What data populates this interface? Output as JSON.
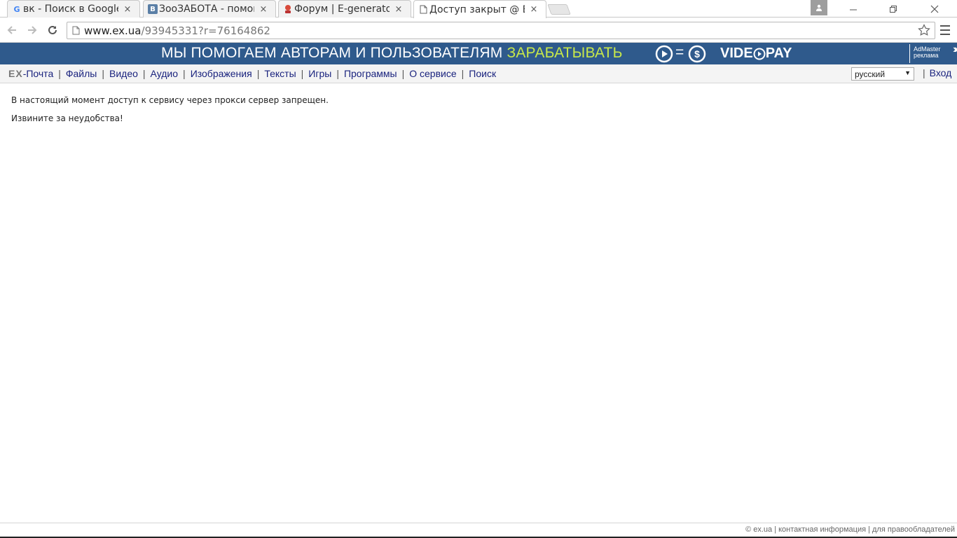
{
  "browser": {
    "tabs": [
      {
        "title": "вк - Поиск в Google",
        "favicon": "google-g"
      },
      {
        "title": "ЗооЗАБОТА - помощ",
        "favicon": "vk-b"
      },
      {
        "title": "Форум | E-generator",
        "favicon": "egenerator"
      },
      {
        "title": "Доступ закрыт @ EX",
        "favicon": "page"
      }
    ],
    "close_glyph": "×",
    "url_host": "www.ex.ua",
    "url_path": "/93945331?r=76164862"
  },
  "banner": {
    "slogan_part1": "МЫ ПОМОГАЕМ АВТОРАМ И ПОЛЬЗОВАТЕЛЯМ ",
    "slogan_highlight": "ЗАРАБАТЫВАТЬ",
    "equals": "=",
    "brand_left": "VIDE",
    "brand_right": "PAY",
    "ad_line1": "AdMaster",
    "ad_line2": "реклама",
    "highlight_color": "#c8e84a",
    "bg_color": "#2f5a8c"
  },
  "nav": {
    "logo": "EX",
    "items": [
      "-Почта",
      "Файлы",
      "Видео",
      "Аудио",
      "Изображения",
      "Тексты",
      "Игры",
      "Программы",
      "О сервисе",
      "Поиск"
    ],
    "separator": "|",
    "language": "русский",
    "login": "Вход"
  },
  "content": {
    "line1": "В настоящий момент доступ к сервису через прокси сервер запрещен.",
    "line2": "Извините за неудобства!"
  },
  "footer": {
    "text": "© ex.ua | контактная информация | для правообладателей"
  }
}
